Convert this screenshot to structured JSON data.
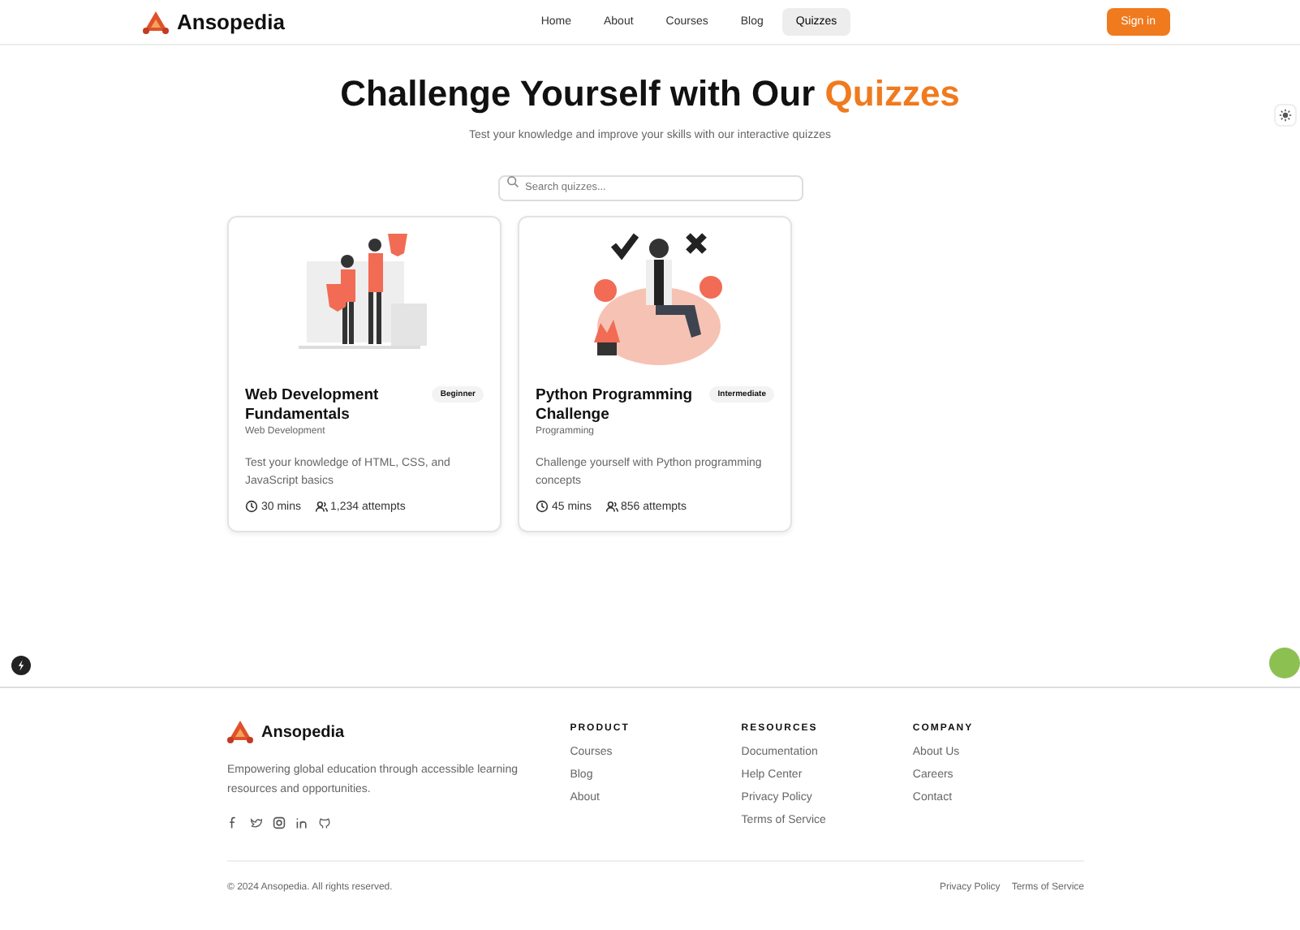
{
  "header": {
    "brand": "Ansopedia",
    "nav": [
      {
        "label": "Home",
        "selected": false
      },
      {
        "label": "About",
        "selected": false
      },
      {
        "label": "Courses",
        "selected": false
      },
      {
        "label": "Blog",
        "selected": false
      },
      {
        "label": "Quizzes",
        "selected": true
      }
    ],
    "sign_in": "Sign in"
  },
  "hero": {
    "title": "Challenge Yourself with Our",
    "title_highlight": "Quizzes",
    "subtitle": "Test your knowledge and improve your skills with our interactive quizzes"
  },
  "search": {
    "placeholder": "Search quizzes..."
  },
  "quizzes": [
    {
      "kind": "web",
      "title": "Web Development Fundamentals",
      "level": "Beginner",
      "category": "Web Development",
      "description": "Test your knowledge of HTML, CSS, and JavaScript basics",
      "duration": "30 mins",
      "attempts": "1,234 attempts"
    },
    {
      "kind": "python",
      "title": "Python Programming Challenge",
      "level": "Intermediate",
      "category": "Programming",
      "description": "Challenge yourself with Python programming concepts",
      "duration": "45 mins",
      "attempts": "856 attempts"
    }
  ],
  "footer": {
    "brand": "Ansopedia",
    "tagline": "Empowering global education through accessible learning resources and opportunities.",
    "columns": [
      {
        "heading": "PRODUCT",
        "links": [
          "Courses",
          "Blog",
          "About"
        ]
      },
      {
        "heading": "RESOURCES",
        "links": [
          "Documentation",
          "Help Center",
          "Privacy Policy",
          "Terms of Service"
        ]
      },
      {
        "heading": "COMPANY",
        "links": [
          "About Us",
          "Careers",
          "Contact"
        ]
      }
    ],
    "copyright": "© 2024 Ansopedia. All rights reserved.",
    "legal": [
      "Privacy Policy",
      "Terms of Service"
    ]
  }
}
